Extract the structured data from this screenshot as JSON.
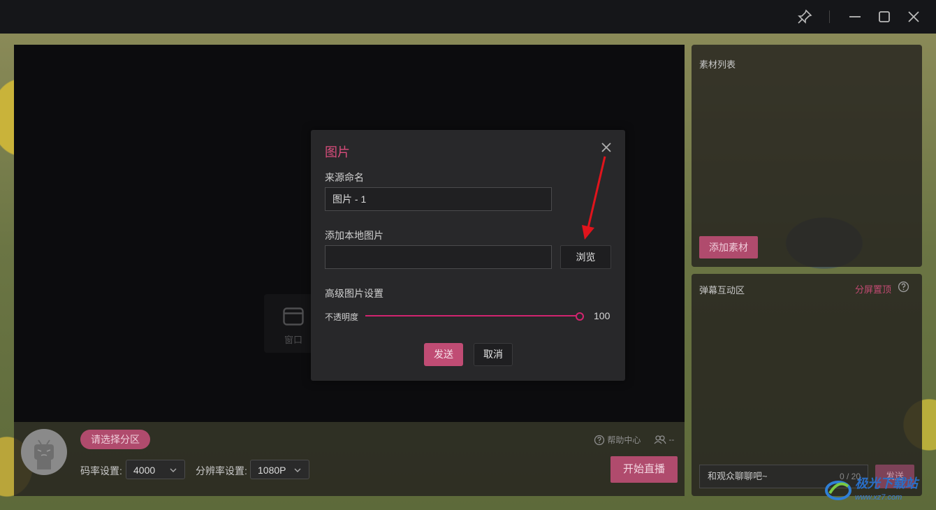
{
  "preview": {
    "window_tile_label": "窗口"
  },
  "dialog": {
    "title": "图片",
    "source_name_label": "来源命名",
    "source_name_value": "图片 - 1",
    "local_image_label": "添加本地图片",
    "local_image_value": "",
    "browse_label": "浏览",
    "advanced_label": "高级图片设置",
    "opacity_label": "不透明度",
    "opacity_value": "100",
    "opacity_fraction": 1.0,
    "send_label": "发送",
    "cancel_label": "取消"
  },
  "bottom_bar": {
    "zone_button": "请选择分区",
    "bitrate_label": "码率设置:",
    "bitrate_value": "4000",
    "resolution_label": "分辨率设置:",
    "resolution_value": "1080P",
    "help_label": "帮助中心",
    "users_label": "--",
    "go_live_label": "开始直播"
  },
  "materials_panel": {
    "title": "素材列表",
    "add_button": "添加素材"
  },
  "danmaku_panel": {
    "title": "弹幕互动区",
    "split_top": "分屏置顶",
    "input_placeholder": "和观众聊聊吧~",
    "count": "0 / 20",
    "send_label": "发送"
  },
  "watermark": {
    "text": "极光下载站",
    "url": "www.xz7.com"
  },
  "colors": {
    "accent": "#c04c74",
    "slider": "#d2246f",
    "title_bar": "#151619"
  }
}
